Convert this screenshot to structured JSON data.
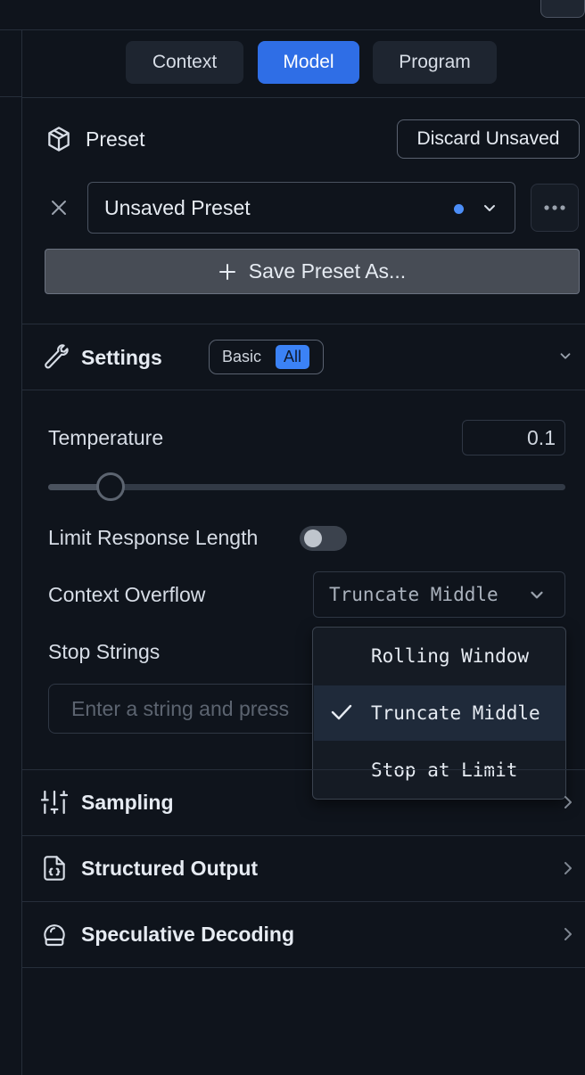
{
  "tabs": [
    {
      "label": "Context",
      "active": false
    },
    {
      "label": "Model",
      "active": true
    },
    {
      "label": "Program",
      "active": false
    }
  ],
  "preset": {
    "title": "Preset",
    "discard_label": "Discard Unsaved",
    "selected": "Unsaved Preset",
    "save_as_label": "Save Preset As..."
  },
  "settings": {
    "title": "Settings",
    "mode_options": [
      "Basic",
      "All"
    ],
    "mode_selected": "All",
    "temperature_label": "Temperature",
    "temperature_value": "0.1",
    "temperature_fraction": 0.1,
    "limit_label": "Limit Response Length",
    "limit_enabled": false,
    "overflow_label": "Context Overflow",
    "overflow_value": "Truncate Middle",
    "overflow_options": [
      "Rolling Window",
      "Truncate Middle",
      "Stop at Limit"
    ],
    "stop_label": "Stop Strings",
    "stop_placeholder": "Enter a string and press"
  },
  "sections": [
    {
      "title": "Sampling",
      "icon": "sliders-icon"
    },
    {
      "title": "Structured Output",
      "icon": "code-file-icon"
    },
    {
      "title": "Speculative Decoding",
      "icon": "head-icon"
    }
  ],
  "colors": {
    "accent": "#2f6ee6",
    "background": "#0f141c",
    "toggle_active": "#3b82f6"
  }
}
